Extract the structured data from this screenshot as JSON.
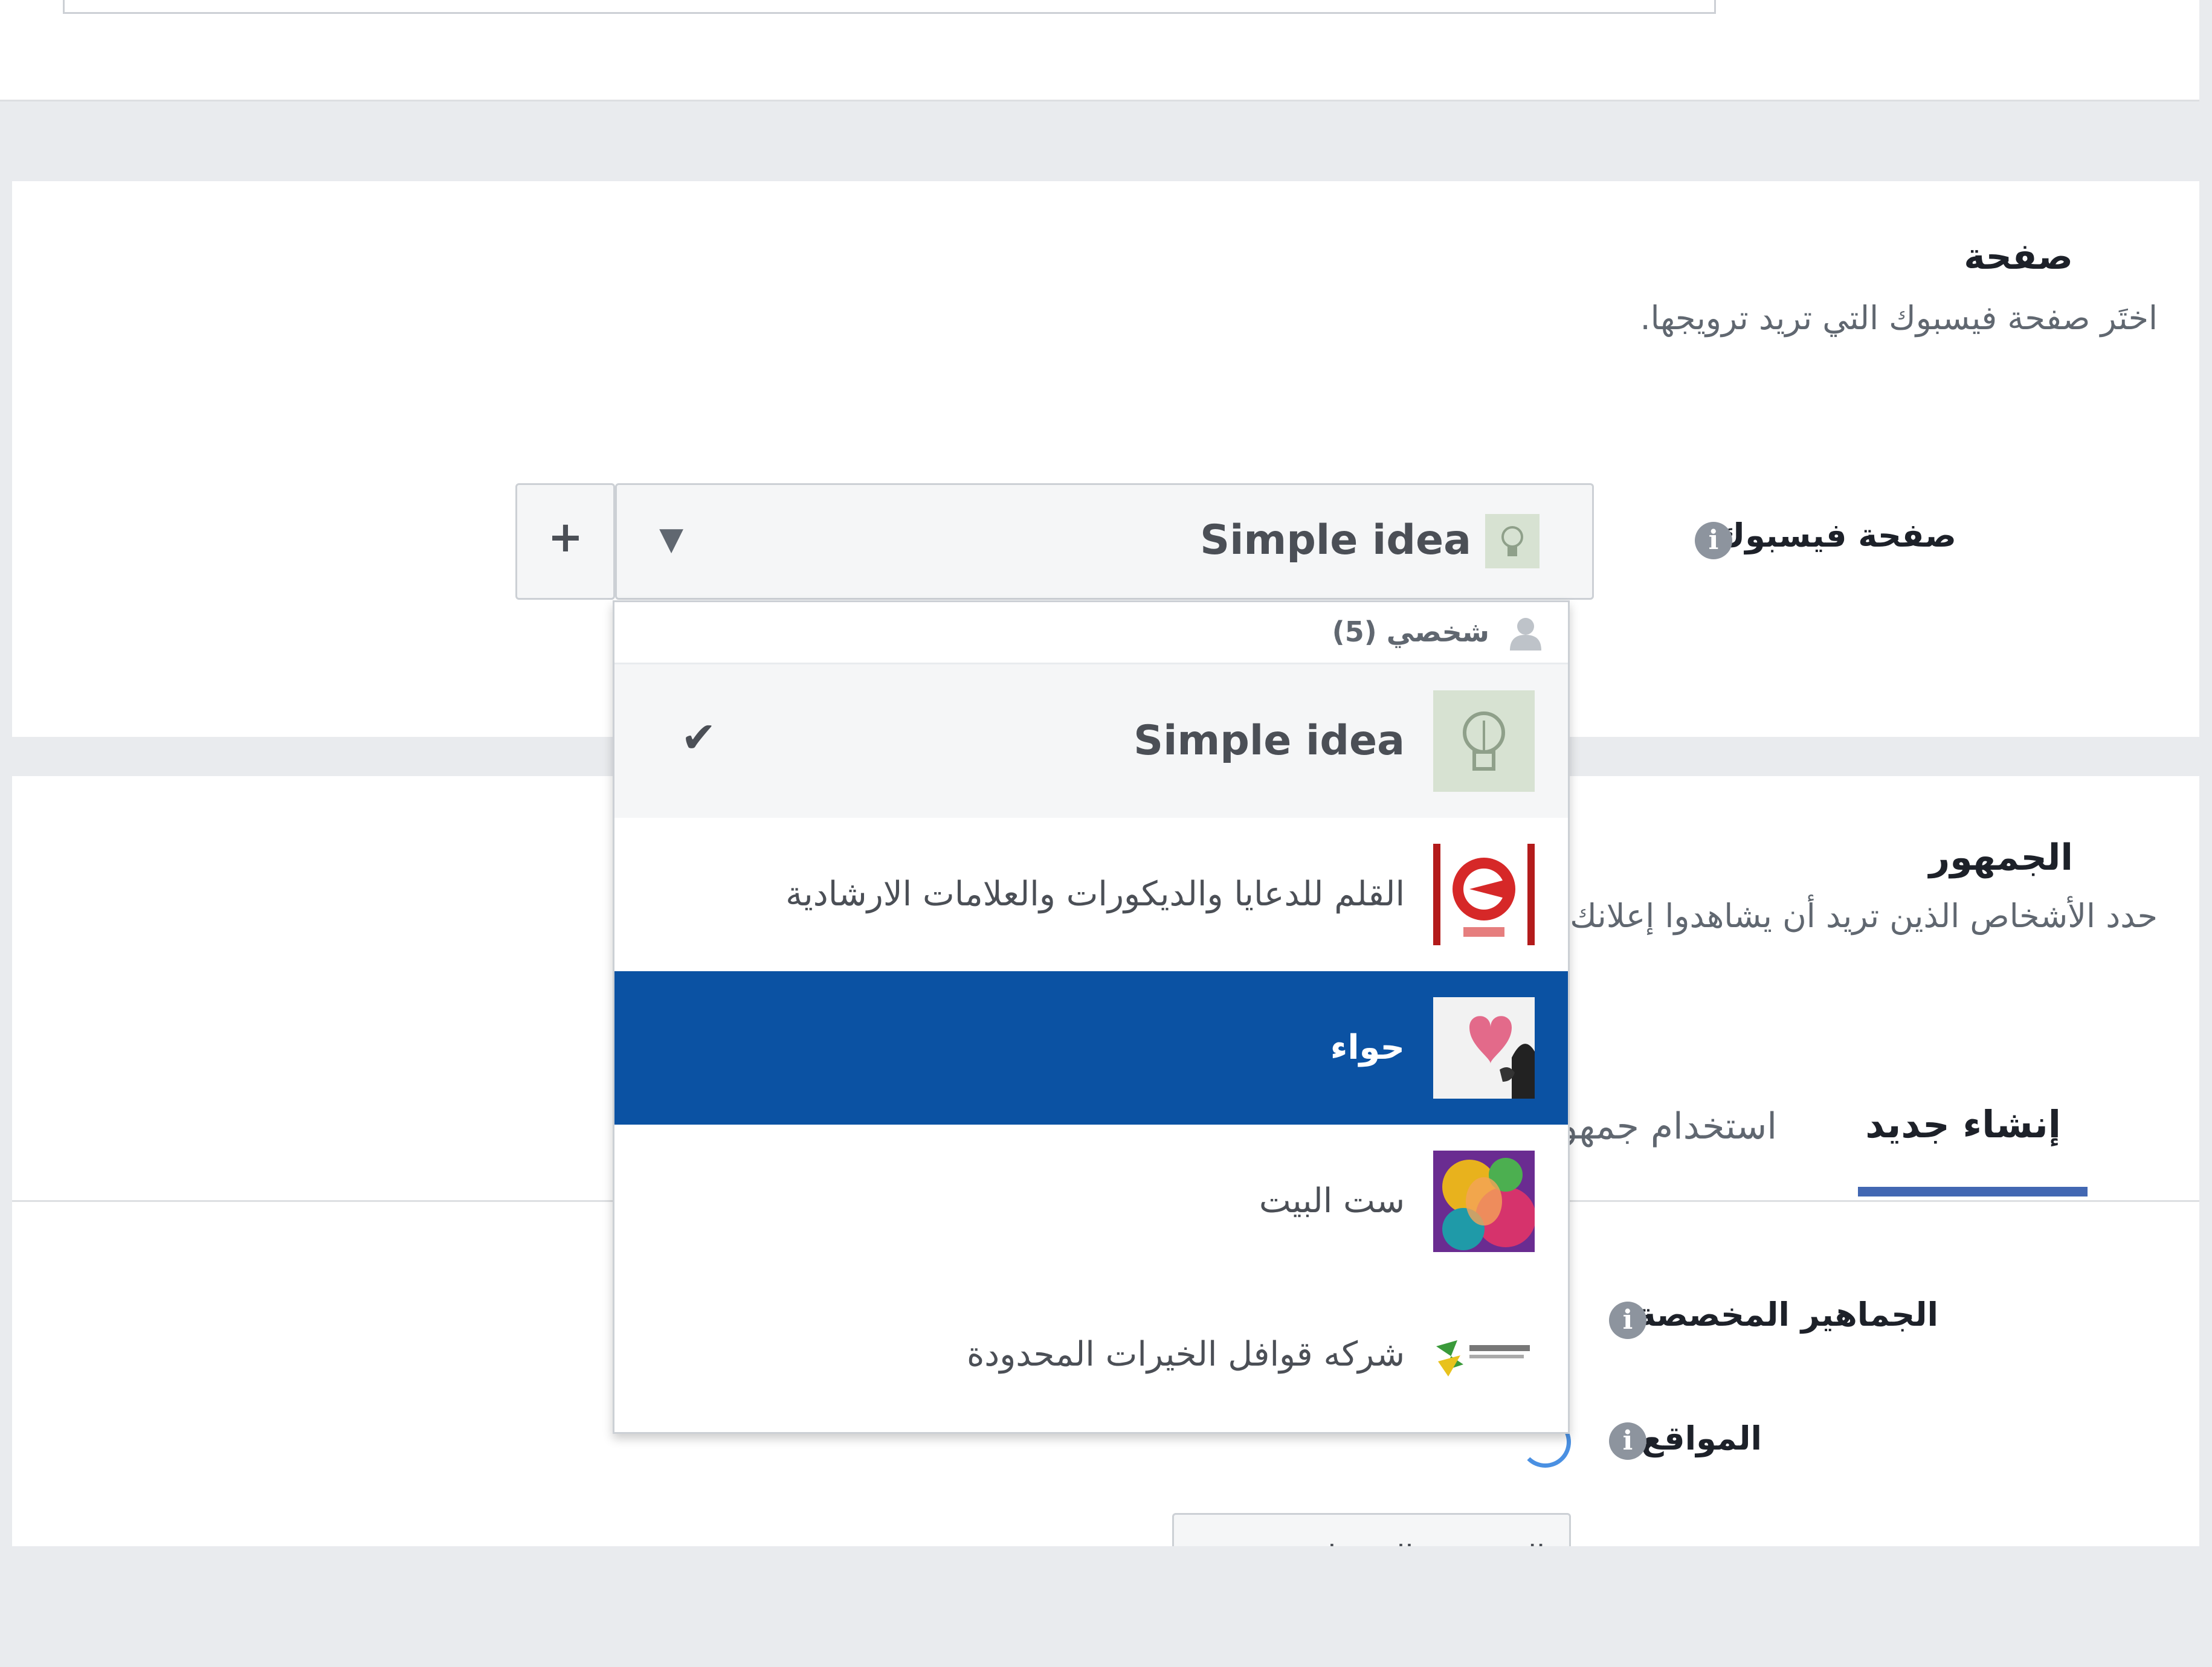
{
  "page_section": {
    "title": "صفحة",
    "subtitle": "اختَر صفحة فيسبوك التي تريد ترويجها.",
    "field_label": "صفحة فيسبوك",
    "info_symbol": "i",
    "add_symbol": "+",
    "selected_page": "Simple idea",
    "caret_symbol": "▾"
  },
  "dropdown": {
    "group_label": "شخصي (5)",
    "items": [
      {
        "label": "Simple idea",
        "state": "selected"
      },
      {
        "label": "القلم للدعايا والديكورات والعلامات الارشادية",
        "state": "normal"
      },
      {
        "label": "حواء",
        "state": "highlighted"
      },
      {
        "label": "ست البيت",
        "state": "normal"
      },
      {
        "label": "شركه قوافل الخيرات المحدودة",
        "state": "normal"
      }
    ],
    "check_symbol": "✔"
  },
  "audience_section": {
    "title": "الجمهور",
    "subtitle": "حدد الأشخاص الذين تريد أن يشاهدوا إعلانك",
    "tabs": [
      {
        "label": "إنشاء جديد",
        "active": true
      },
      {
        "label": "استخدام جمهور محفوظ",
        "active": false
      }
    ],
    "custom_audiences_label": "الجماهير المخصصة",
    "locations_label": "المواقع",
    "partial_button_label": "المجموعة المفضلة"
  },
  "colors": {
    "highlight": "#0b52a3",
    "tab_underline": "#4267b2",
    "background": "#e9ebee"
  }
}
